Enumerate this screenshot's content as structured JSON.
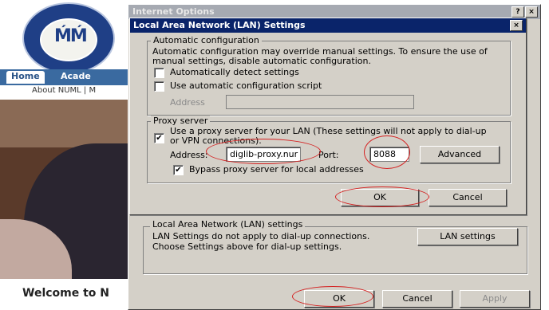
{
  "site": {
    "nav_home": "Home",
    "nav_academics": "Acade",
    "subnav": "About NUML | M",
    "welcome": "Welcome to N"
  },
  "internet_options": {
    "title": "Internet Options",
    "help_btn": "?",
    "close_btn": "×",
    "lan_group_label": "Local Area Network (LAN) settings",
    "lan_group_desc": "LAN Settings do not apply to dial-up connections. Choose Settings above for dial-up settings.",
    "lan_settings_btn": "LAN settings",
    "ok": "OK",
    "cancel": "Cancel",
    "apply": "Apply"
  },
  "lan_dialog": {
    "title": "Local Area Network (LAN) Settings",
    "close_btn": "×",
    "auto_config": {
      "label": "Automatic configuration",
      "desc": "Automatic configuration may override manual settings.  To ensure the use of manual settings, disable automatic configuration.",
      "detect_label": "Automatically detect settings",
      "detect_checked": false,
      "script_label": "Use automatic configuration script",
      "script_checked": false,
      "address_label": "Address"
    },
    "proxy": {
      "label": "Proxy server",
      "use_proxy_label": "Use a proxy server for your LAN (These settings will not apply to dial-up or VPN connections).",
      "use_proxy_checked": true,
      "check_mark": "✔",
      "address_label": "Address:",
      "address_value": "diglib-proxy.nur",
      "port_label": "Port:",
      "port_value": "8088",
      "advanced_btn": "Advanced",
      "bypass_label": "Bypass proxy server for local addresses",
      "bypass_checked": true
    },
    "ok": "OK",
    "cancel": "Cancel"
  },
  "colors": {
    "dialog_face": "#d4d0c8",
    "active_title": "#0a246a",
    "inactive_title": "#a6aab2",
    "highlight_ring": "#d42020"
  }
}
